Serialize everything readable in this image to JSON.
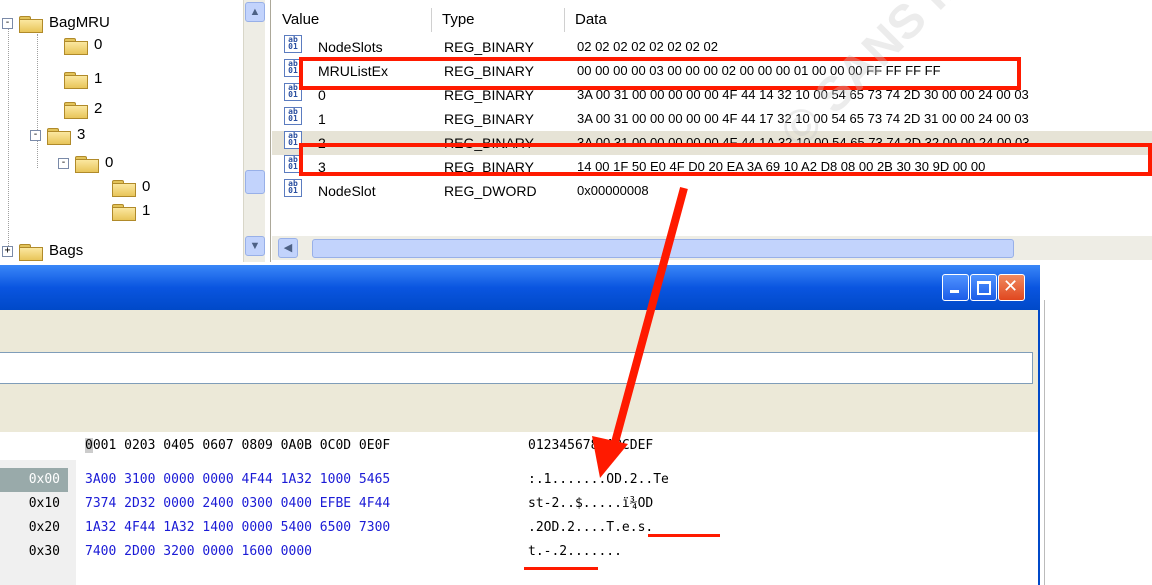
{
  "registry": {
    "tree": {
      "items": [
        {
          "label": "BagMRU",
          "expander": "-"
        },
        {
          "label": "0"
        },
        {
          "label": "1"
        },
        {
          "label": "2"
        },
        {
          "label": "3",
          "expander": "-"
        },
        {
          "label": "0",
          "expander": "-"
        },
        {
          "label": "0"
        },
        {
          "label": "1"
        },
        {
          "label": "Bags",
          "expander": "+"
        }
      ]
    },
    "columns": {
      "value": "Value",
      "type": "Type",
      "data": "Data"
    },
    "rows": [
      {
        "name": "NodeSlots",
        "type": "REG_BINARY",
        "data": "02 02 02 02 02 02 02 02"
      },
      {
        "name": "MRUListEx",
        "type": "REG_BINARY",
        "data": "00 00 00 00 03 00 00 00 02 00 00 00 01 00 00 00 FF FF FF FF"
      },
      {
        "name": "0",
        "type": "REG_BINARY",
        "data": "3A 00 31 00 00 00 00 00 4F 44 14 32 10 00 54 65 73 74 2D 30 00 00 24 00 03"
      },
      {
        "name": "1",
        "type": "REG_BINARY",
        "data": "3A 00 31 00 00 00 00 00 4F 44 17 32 10 00 54 65 73 74 2D 31 00 00 24 00 03"
      },
      {
        "name": "2",
        "type": "REG_BINARY",
        "data": "3A 00 31 00 00 00 00 00 4F 44 1A 32 10 00 54 65 73 74 2D 32 00 00 24 00 03"
      },
      {
        "name": "3",
        "type": "REG_BINARY",
        "data": "14 00 1F 50 E0 4F D0 20 EA 3A 69 10 A2 D8 08 00 2B 30 30 9D 00 00"
      },
      {
        "name": "NodeSlot",
        "type": "REG_DWORD",
        "data": "0x00000008"
      }
    ],
    "icon": "registry-value-icon"
  },
  "hexeditor": {
    "header_cursor": "0",
    "header_hex": "001 0203 0405 0607 0809 0A0B 0C0D 0E0F",
    "header_ascii": "0123456789ABCDEF",
    "rows": [
      {
        "offset": "0x00",
        "hex": "3A00 3100 0000 0000 4F44 1A32 1000 5465",
        "ascii": ":.1.......OD.2..Te"
      },
      {
        "offset": "0x10",
        "hex": "7374 2D32 0000 2400 0300 0400 EFBE 4F44",
        "ascii": "st-2..$.....ï¾OD"
      },
      {
        "offset": "0x20",
        "hex": "1A32 4F44 1A32 1400 0000 5400 6500 7300",
        "ascii": ".2OD.2....T.e.s."
      },
      {
        "offset": "0x30",
        "hex": "7400 2D00 3200 0000 1600 0000",
        "ascii": "t.-.2......."
      }
    ],
    "window_buttons": [
      "minimize-icon",
      "maximize-icon",
      "close-icon"
    ]
  },
  "watermark": "© SANS Institute, Author retains full rights.",
  "colors": {
    "highlight": "#ff1a00",
    "titlebar": "#0a55e0",
    "hex_text": "#1b1bd6",
    "close_button": "#e0471f"
  }
}
